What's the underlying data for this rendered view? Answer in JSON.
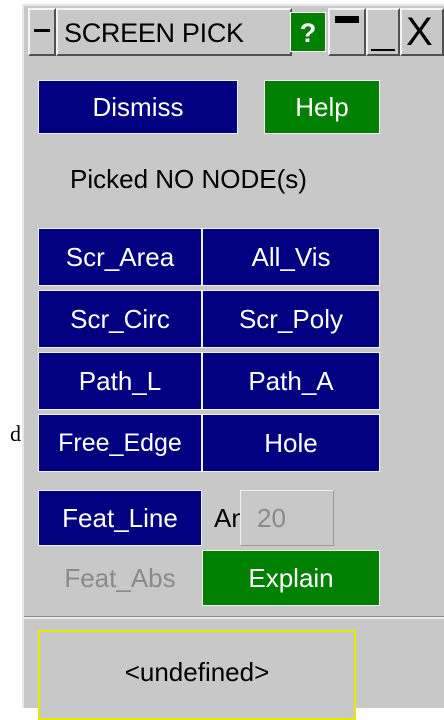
{
  "stray_char": "d",
  "titlebar": {
    "title": "SCREEN PICK",
    "help_label": "?",
    "close_label": "X",
    "menu_icon": "dash-icon",
    "min_icon": "minimize-icon",
    "max_icon": "maximize-icon"
  },
  "top_buttons": {
    "dismiss": "Dismiss",
    "help": "Help"
  },
  "status_text": "Picked NO NODE(s)",
  "pick_buttons": {
    "scr_area": "Scr_Area",
    "all_vis": "All_Vis",
    "scr_circ": "Scr_Circ",
    "scr_poly": "Scr_Poly",
    "path_l": "Path_L",
    "path_a": "Path_A",
    "free_edge": "Free_Edge",
    "hole": "Hole"
  },
  "feature": {
    "feat_line": "Feat_Line",
    "ang_label": "Ang",
    "ang_value": "20",
    "feat_abs": "Feat_Abs",
    "explain": "Explain"
  },
  "output_text": "<undefined>",
  "colors": {
    "panel": "#c8c8c8",
    "navy": "#000080",
    "green": "#008000",
    "highlight_border": "#e8e800"
  }
}
